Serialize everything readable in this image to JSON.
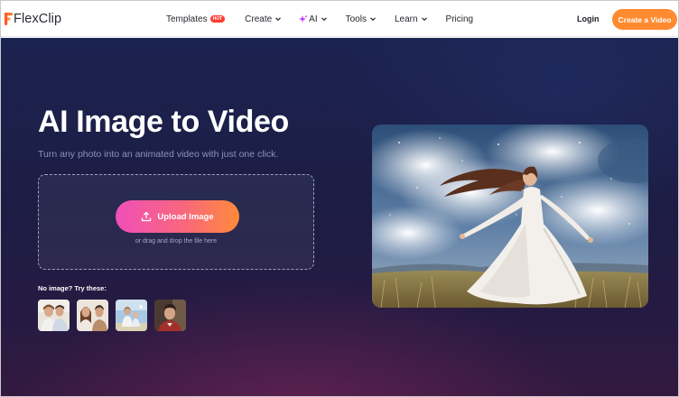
{
  "brand": {
    "name": "FlexClip"
  },
  "nav": {
    "items": [
      {
        "label": "Templates",
        "badge": "HOT"
      },
      {
        "label": "Create"
      },
      {
        "label": "AI"
      },
      {
        "label": "Tools"
      },
      {
        "label": "Learn"
      },
      {
        "label": "Pricing"
      }
    ],
    "login": "Login",
    "cta": "Create a Video"
  },
  "hero": {
    "title": "AI Image to Video",
    "subtitle": "Turn any photo into an animated video with just one click.",
    "upload_label": "Upload Image",
    "drop_hint": "or drag and drop the file here",
    "try_label": "No image? Try these:",
    "samples": [
      "couple-photo",
      "couple-photo",
      "family-photo",
      "man-portrait"
    ]
  },
  "colors": {
    "accent": "#ff8a30",
    "hot_badge": "#ff3b30",
    "upload_gradient_start": "#f04fb8",
    "upload_gradient_end": "#ff8a3a"
  },
  "icons": [
    "chevron-down-icon",
    "ai-sparkle-icon",
    "upload-icon"
  ]
}
